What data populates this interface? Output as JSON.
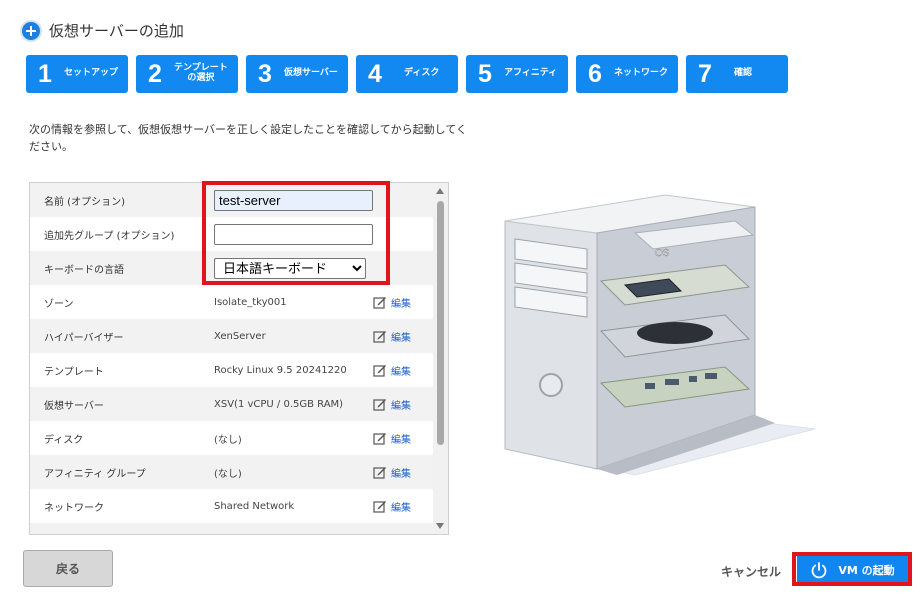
{
  "header": {
    "title": "仮想サーバーの追加",
    "icon": "plus-circle-icon"
  },
  "steps": [
    {
      "num": "1",
      "label": "セットアップ"
    },
    {
      "num": "2",
      "label_line1": "テンプレート",
      "label_line2": "の選択"
    },
    {
      "num": "3",
      "label": "仮想サーバー"
    },
    {
      "num": "4",
      "label": "ディスク"
    },
    {
      "num": "5",
      "label": "アフィニティ"
    },
    {
      "num": "6",
      "label": "ネットワーク"
    },
    {
      "num": "7",
      "label": "確認"
    }
  ],
  "intro": "次の情報を参照して、仮想仮想サーバーを正しく設定したことを確認してから起動してください。",
  "form": {
    "name_label": "名前 (オプション)",
    "name_value": "test-server",
    "group_label": "追加先グループ (オプション)",
    "group_value": "",
    "keyboard_label": "キーボードの言語",
    "keyboard_value": "日本語キーボード",
    "keyboard_options": [
      "日本語キーボード"
    ]
  },
  "summary": [
    {
      "label": "ゾーン",
      "value": "Isolate_tky001",
      "edit": "編集"
    },
    {
      "label": "ハイパーバイザー",
      "value": "XenServer",
      "edit": "編集"
    },
    {
      "label": "テンプレート",
      "value": "Rocky Linux 9.5 20241220",
      "edit": "編集"
    },
    {
      "label": "仮想サーバー",
      "value": "XSV(1 vCPU / 0.5GB RAM)",
      "edit": "編集"
    },
    {
      "label": "ディスク",
      "value": "(なし)",
      "edit": "編集"
    },
    {
      "label": "アフィニティ グループ",
      "value": "(なし)",
      "edit": "編集"
    },
    {
      "label": "ネットワーク",
      "value": "Shared Network",
      "edit": "編集"
    }
  ],
  "illustration": {
    "os_label": "OS"
  },
  "footer": {
    "back_label": "戻る",
    "cancel_label": "キャンセル",
    "launch_label": "VM の起動"
  },
  "colors": {
    "accent": "#1289f0",
    "highlight": "#e0151b",
    "link": "#1a5fd0"
  }
}
